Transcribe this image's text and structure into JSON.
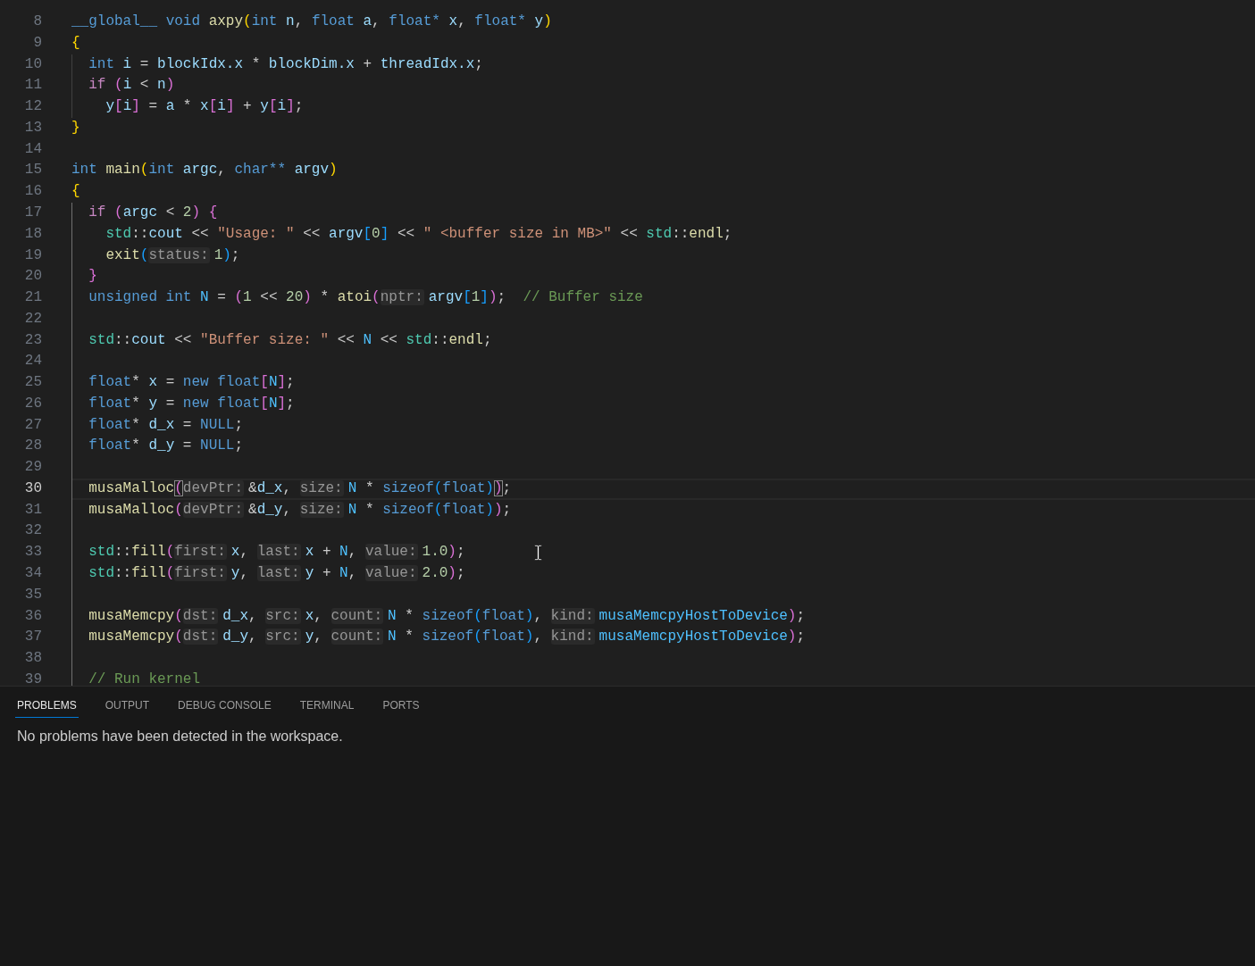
{
  "editor": {
    "lines": [
      {
        "number": "8",
        "selected": false,
        "tokens": [
          {
            "text": "__global__ ",
            "kind": "storage"
          },
          {
            "text": "void ",
            "kind": "storage"
          },
          {
            "text": "axpy",
            "kind": "function"
          },
          {
            "text": "(",
            "kind": "open"
          },
          {
            "text": "int ",
            "kind": "storage"
          },
          {
            "text": "n",
            "kind": "variable"
          },
          {
            "text": ", ",
            "kind": "plain"
          },
          {
            "text": "float ",
            "kind": "storage"
          },
          {
            "text": "a",
            "kind": "variable"
          },
          {
            "text": ", ",
            "kind": "plain"
          },
          {
            "text": "float* ",
            "kind": "storage"
          },
          {
            "text": "x",
            "kind": "variable"
          },
          {
            "text": ", ",
            "kind": "plain"
          },
          {
            "text": "float* ",
            "kind": "storage"
          },
          {
            "text": "y",
            "kind": "variable"
          },
          {
            "text": ")",
            "kind": "close"
          }
        ]
      },
      {
        "number": "9",
        "selected": false,
        "tokens": [
          {
            "text": "{",
            "kind": "open"
          }
        ]
      },
      {
        "number": "10",
        "selected": false,
        "tokens": [
          {
            "text": "  int ",
            "kind": "storage"
          },
          {
            "text": "i",
            "kind": "variable"
          },
          {
            "text": " = ",
            "kind": "plain"
          },
          {
            "text": "blockIdx.x",
            "kind": "variable"
          },
          {
            "text": " * ",
            "kind": "plain"
          },
          {
            "text": "blockDim.x",
            "kind": "variable"
          },
          {
            "text": " + ",
            "kind": "plain"
          },
          {
            "text": "threadIdx.x",
            "kind": "variable"
          },
          {
            "text": ";",
            "kind": "plain"
          }
        ]
      },
      {
        "number": "11",
        "selected": false,
        "tokens": [
          {
            "text": "  if ",
            "kind": "keyword"
          },
          {
            "text": "(",
            "kind": "open"
          },
          {
            "text": "i",
            "kind": "variable"
          },
          {
            "text": " < ",
            "kind": "plain"
          },
          {
            "text": "n",
            "kind": "variable"
          },
          {
            "text": ")",
            "kind": "close"
          }
        ]
      },
      {
        "number": "12",
        "selected": false,
        "tokens": [
          {
            "text": "    y",
            "kind": "variable"
          },
          {
            "text": "[",
            "kind": "open"
          },
          {
            "text": "i",
            "kind": "variable"
          },
          {
            "text": "]",
            "kind": "close"
          },
          {
            "text": " = ",
            "kind": "plain"
          },
          {
            "text": "a",
            "kind": "variable"
          },
          {
            "text": " * ",
            "kind": "plain"
          },
          {
            "text": "x",
            "kind": "variable"
          },
          {
            "text": "[",
            "kind": "open"
          },
          {
            "text": "i",
            "kind": "variable"
          },
          {
            "text": "]",
            "kind": "close"
          },
          {
            "text": " + ",
            "kind": "plain"
          },
          {
            "text": "y",
            "kind": "variable"
          },
          {
            "text": "[",
            "kind": "open"
          },
          {
            "text": "i",
            "kind": "variable"
          },
          {
            "text": "]",
            "kind": "close"
          },
          {
            "text": ";",
            "kind": "plain"
          }
        ]
      },
      {
        "number": "13",
        "selected": false,
        "tokens": [
          {
            "text": "}",
            "kind": "close"
          }
        ]
      },
      {
        "number": "14",
        "selected": false
      },
      {
        "number": "15",
        "selected": false,
        "tokens": [
          {
            "text": "int ",
            "kind": "storage"
          },
          {
            "text": "main",
            "kind": "function"
          },
          {
            "text": "(",
            "kind": "open"
          },
          {
            "text": "int ",
            "kind": "storage"
          },
          {
            "text": "argc",
            "kind": "variable"
          },
          {
            "text": ", ",
            "kind": "plain"
          },
          {
            "text": "char** ",
            "kind": "storage"
          },
          {
            "text": "argv",
            "kind": "variable"
          },
          {
            "text": ")",
            "kind": "close"
          }
        ]
      },
      {
        "number": "16",
        "selected": false,
        "tokens": [
          {
            "text": "{",
            "kind": "open"
          }
        ]
      },
      {
        "number": "17",
        "selected": false,
        "tokens": [
          {
            "text": "  if ",
            "kind": "keyword"
          },
          {
            "text": "(",
            "kind": "open"
          },
          {
            "text": "argc",
            "kind": "variable"
          },
          {
            "text": " < ",
            "kind": "plain"
          },
          {
            "text": "2",
            "kind": "number"
          },
          {
            "text": ")",
            "kind": "close"
          },
          {
            "text": " {",
            "kind": "open"
          }
        ]
      },
      {
        "number": "18",
        "selected": false,
        "tokens": [
          {
            "text": "    std",
            "kind": "namespace"
          },
          {
            "text": "::",
            "kind": "plain"
          },
          {
            "text": "cout",
            "kind": "variable"
          },
          {
            "text": " << ",
            "kind": "plain"
          },
          {
            "text": "\"Usage: \"",
            "kind": "string"
          },
          {
            "text": " << ",
            "kind": "plain"
          },
          {
            "text": "argv",
            "kind": "variable"
          },
          {
            "text": "[",
            "kind": "open"
          },
          {
            "text": "0",
            "kind": "number"
          },
          {
            "text": "]",
            "kind": "close"
          },
          {
            "text": " << ",
            "kind": "plain"
          },
          {
            "text": "\" <buffer size in MB>\"",
            "kind": "string"
          },
          {
            "text": " << ",
            "kind": "plain"
          },
          {
            "text": "std",
            "kind": "namespace"
          },
          {
            "text": "::",
            "kind": "plain"
          },
          {
            "text": "endl",
            "kind": "function"
          },
          {
            "text": ";",
            "kind": "plain"
          }
        ]
      },
      {
        "number": "19",
        "selected": false,
        "tokens": [
          {
            "text": "    exit",
            "kind": "function"
          },
          {
            "text": "(",
            "kind": "open"
          },
          {
            "text": "status:",
            "kind": "hint"
          },
          {
            "text": "1",
            "kind": "number"
          },
          {
            "text": ")",
            "kind": "close"
          },
          {
            "text": ";",
            "kind": "plain"
          }
        ]
      },
      {
        "number": "20",
        "selected": false,
        "tokens": [
          {
            "text": "  }",
            "kind": "close"
          }
        ]
      },
      {
        "number": "21",
        "selected": false,
        "tokens": [
          {
            "text": "  unsigned int ",
            "kind": "storage"
          },
          {
            "text": "N",
            "kind": "constant"
          },
          {
            "text": " = ",
            "kind": "plain"
          },
          {
            "text": "(",
            "kind": "open"
          },
          {
            "text": "1",
            "kind": "number"
          },
          {
            "text": " << ",
            "kind": "plain"
          },
          {
            "text": "20",
            "kind": "number"
          },
          {
            "text": ")",
            "kind": "close"
          },
          {
            "text": " * ",
            "kind": "plain"
          },
          {
            "text": "atoi",
            "kind": "function"
          },
          {
            "text": "(",
            "kind": "open"
          },
          {
            "text": "nptr:",
            "kind": "hint"
          },
          {
            "text": "argv",
            "kind": "variable"
          },
          {
            "text": "[",
            "kind": "open"
          },
          {
            "text": "1",
            "kind": "number"
          },
          {
            "text": "]",
            "kind": "close"
          },
          {
            "text": ")",
            "kind": "close"
          },
          {
            "text": ";  ",
            "kind": "plain"
          },
          {
            "text": "// Buffer size",
            "kind": "comment"
          }
        ]
      },
      {
        "number": "22",
        "selected": false
      },
      {
        "number": "23",
        "selected": false,
        "tokens": [
          {
            "text": "  std",
            "kind": "namespace"
          },
          {
            "text": "::",
            "kind": "plain"
          },
          {
            "text": "cout",
            "kind": "variable"
          },
          {
            "text": " << ",
            "kind": "plain"
          },
          {
            "text": "\"Buffer size: \"",
            "kind": "string"
          },
          {
            "text": " << ",
            "kind": "plain"
          },
          {
            "text": "N",
            "kind": "constant"
          },
          {
            "text": " << ",
            "kind": "plain"
          },
          {
            "text": "std",
            "kind": "namespace"
          },
          {
            "text": "::",
            "kind": "plain"
          },
          {
            "text": "endl",
            "kind": "function"
          },
          {
            "text": ";",
            "kind": "plain"
          }
        ]
      },
      {
        "number": "24",
        "selected": false
      },
      {
        "number": "25",
        "selected": false,
        "tokens": [
          {
            "text": "  float",
            "kind": "storage"
          },
          {
            "text": "* ",
            "kind": "plain"
          },
          {
            "text": "x",
            "kind": "variable"
          },
          {
            "text": " = ",
            "kind": "plain"
          },
          {
            "text": "new float",
            "kind": "storage"
          },
          {
            "text": "[",
            "kind": "open"
          },
          {
            "text": "N",
            "kind": "constant"
          },
          {
            "text": "]",
            "kind": "close"
          },
          {
            "text": ";",
            "kind": "plain"
          }
        ]
      },
      {
        "number": "26",
        "selected": false,
        "tokens": [
          {
            "text": "  float",
            "kind": "storage"
          },
          {
            "text": "* ",
            "kind": "plain"
          },
          {
            "text": "y",
            "kind": "variable"
          },
          {
            "text": " = ",
            "kind": "plain"
          },
          {
            "text": "new float",
            "kind": "storage"
          },
          {
            "text": "[",
            "kind": "open"
          },
          {
            "text": "N",
            "kind": "constant"
          },
          {
            "text": "]",
            "kind": "close"
          },
          {
            "text": ";",
            "kind": "plain"
          }
        ]
      },
      {
        "number": "27",
        "selected": false,
        "tokens": [
          {
            "text": "  float",
            "kind": "storage"
          },
          {
            "text": "* ",
            "kind": "plain"
          },
          {
            "text": "d_x",
            "kind": "variable"
          },
          {
            "text": " = ",
            "kind": "plain"
          },
          {
            "text": "NULL",
            "kind": "storage"
          },
          {
            "text": ";",
            "kind": "plain"
          }
        ]
      },
      {
        "number": "28",
        "selected": false,
        "tokens": [
          {
            "text": "  float",
            "kind": "storage"
          },
          {
            "text": "* ",
            "kind": "plain"
          },
          {
            "text": "d_y",
            "kind": "variable"
          },
          {
            "text": " = ",
            "kind": "plain"
          },
          {
            "text": "NULL",
            "kind": "storage"
          },
          {
            "text": ";",
            "kind": "plain"
          }
        ]
      },
      {
        "number": "29",
        "selected": false
      },
      {
        "number": "30",
        "selected": true,
        "tokens": [
          {
            "text": "  musaMalloc",
            "kind": "function"
          },
          {
            "text": "(",
            "kind": "open_matched"
          },
          {
            "text": "devPtr:",
            "kind": "hint"
          },
          {
            "text": "&",
            "kind": "plain"
          },
          {
            "text": "d_x",
            "kind": "variable"
          },
          {
            "text": ", ",
            "kind": "plain"
          },
          {
            "text": "size:",
            "kind": "hint"
          },
          {
            "text": "N",
            "kind": "constant"
          },
          {
            "text": " * ",
            "kind": "plain"
          },
          {
            "text": "sizeof",
            "kind": "storage"
          },
          {
            "text": "(",
            "kind": "open"
          },
          {
            "text": "float",
            "kind": "storage"
          },
          {
            "text": ")",
            "kind": "close"
          },
          {
            "text": ")",
            "kind": "close_matched"
          },
          {
            "text": ";",
            "kind": "plain"
          }
        ]
      },
      {
        "number": "31",
        "selected": false,
        "tokens": [
          {
            "text": "  musaMalloc",
            "kind": "function"
          },
          {
            "text": "(",
            "kind": "open"
          },
          {
            "text": "devPtr:",
            "kind": "hint"
          },
          {
            "text": "&",
            "kind": "plain"
          },
          {
            "text": "d_y",
            "kind": "variable"
          },
          {
            "text": ", ",
            "kind": "plain"
          },
          {
            "text": "size:",
            "kind": "hint"
          },
          {
            "text": "N",
            "kind": "constant"
          },
          {
            "text": " * ",
            "kind": "plain"
          },
          {
            "text": "sizeof",
            "kind": "storage"
          },
          {
            "text": "(",
            "kind": "open"
          },
          {
            "text": "float",
            "kind": "storage"
          },
          {
            "text": ")",
            "kind": "close"
          },
          {
            "text": ")",
            "kind": "close"
          },
          {
            "text": ";",
            "kind": "plain"
          }
        ]
      },
      {
        "number": "32",
        "selected": false
      },
      {
        "number": "33",
        "selected": false,
        "tokens": [
          {
            "text": "  std",
            "kind": "namespace"
          },
          {
            "text": "::",
            "kind": "plain"
          },
          {
            "text": "fill",
            "kind": "function"
          },
          {
            "text": "(",
            "kind": "open"
          },
          {
            "text": "first:",
            "kind": "hint"
          },
          {
            "text": "x",
            "kind": "variable"
          },
          {
            "text": ", ",
            "kind": "plain"
          },
          {
            "text": "last:",
            "kind": "hint"
          },
          {
            "text": "x",
            "kind": "variable"
          },
          {
            "text": " + ",
            "kind": "plain"
          },
          {
            "text": "N",
            "kind": "constant"
          },
          {
            "text": ", ",
            "kind": "plain"
          },
          {
            "text": "value:",
            "kind": "hint"
          },
          {
            "text": "1.0",
            "kind": "number"
          },
          {
            "text": ")",
            "kind": "close"
          },
          {
            "text": ";",
            "kind": "plain"
          }
        ]
      },
      {
        "number": "34",
        "selected": false,
        "tokens": [
          {
            "text": "  std",
            "kind": "namespace"
          },
          {
            "text": "::",
            "kind": "plain"
          },
          {
            "text": "fill",
            "kind": "function"
          },
          {
            "text": "(",
            "kind": "open"
          },
          {
            "text": "first:",
            "kind": "hint"
          },
          {
            "text": "y",
            "kind": "variable"
          },
          {
            "text": ", ",
            "kind": "plain"
          },
          {
            "text": "last:",
            "kind": "hint"
          },
          {
            "text": "y",
            "kind": "variable"
          },
          {
            "text": " + ",
            "kind": "plain"
          },
          {
            "text": "N",
            "kind": "constant"
          },
          {
            "text": ", ",
            "kind": "plain"
          },
          {
            "text": "value:",
            "kind": "hint"
          },
          {
            "text": "2.0",
            "kind": "number"
          },
          {
            "text": ")",
            "kind": "close"
          },
          {
            "text": ";",
            "kind": "plain"
          }
        ]
      },
      {
        "number": "35",
        "selected": false
      },
      {
        "number": "36",
        "selected": false,
        "tokens": [
          {
            "text": "  musaMemcpy",
            "kind": "function"
          },
          {
            "text": "(",
            "kind": "open"
          },
          {
            "text": "dst:",
            "kind": "hint"
          },
          {
            "text": "d_x",
            "kind": "variable"
          },
          {
            "text": ", ",
            "kind": "plain"
          },
          {
            "text": "src:",
            "kind": "hint"
          },
          {
            "text": "x",
            "kind": "variable"
          },
          {
            "text": ", ",
            "kind": "plain"
          },
          {
            "text": "count:",
            "kind": "hint"
          },
          {
            "text": "N",
            "kind": "constant"
          },
          {
            "text": " * ",
            "kind": "plain"
          },
          {
            "text": "sizeof",
            "kind": "storage"
          },
          {
            "text": "(",
            "kind": "open"
          },
          {
            "text": "float",
            "kind": "storage"
          },
          {
            "text": ")",
            "kind": "close"
          },
          {
            "text": ", ",
            "kind": "plain"
          },
          {
            "text": "kind:",
            "kind": "hint"
          },
          {
            "text": "musaMemcpyHostToDevice",
            "kind": "constant"
          },
          {
            "text": ")",
            "kind": "close"
          },
          {
            "text": ";",
            "kind": "plain"
          }
        ]
      },
      {
        "number": "37",
        "selected": false,
        "tokens": [
          {
            "text": "  musaMemcpy",
            "kind": "function"
          },
          {
            "text": "(",
            "kind": "open"
          },
          {
            "text": "dst:",
            "kind": "hint"
          },
          {
            "text": "d_y",
            "kind": "variable"
          },
          {
            "text": ", ",
            "kind": "plain"
          },
          {
            "text": "src:",
            "kind": "hint"
          },
          {
            "text": "y",
            "kind": "variable"
          },
          {
            "text": ", ",
            "kind": "plain"
          },
          {
            "text": "count:",
            "kind": "hint"
          },
          {
            "text": "N",
            "kind": "constant"
          },
          {
            "text": " * ",
            "kind": "plain"
          },
          {
            "text": "sizeof",
            "kind": "storage"
          },
          {
            "text": "(",
            "kind": "open"
          },
          {
            "text": "float",
            "kind": "storage"
          },
          {
            "text": ")",
            "kind": "close"
          },
          {
            "text": ", ",
            "kind": "plain"
          },
          {
            "text": "kind:",
            "kind": "hint"
          },
          {
            "text": "musaMemcpyHostToDevice",
            "kind": "constant"
          },
          {
            "text": ")",
            "kind": "close"
          },
          {
            "text": ";",
            "kind": "plain"
          }
        ]
      },
      {
        "number": "38",
        "selected": false
      },
      {
        "number": "39",
        "selected": false,
        "tokens": [
          {
            "text": "  // Run kernel",
            "kind": "comment"
          }
        ]
      }
    ]
  },
  "panel": {
    "tabs": [
      {
        "label": "PROBLEMS",
        "selected": true
      },
      {
        "label": "OUTPUT",
        "selected": false
      },
      {
        "label": "DEBUG CONSOLE",
        "selected": false
      },
      {
        "label": "TERMINAL",
        "selected": false
      },
      {
        "label": "PORTS",
        "selected": false
      }
    ],
    "message": "No problems have been detected in the workspace."
  }
}
